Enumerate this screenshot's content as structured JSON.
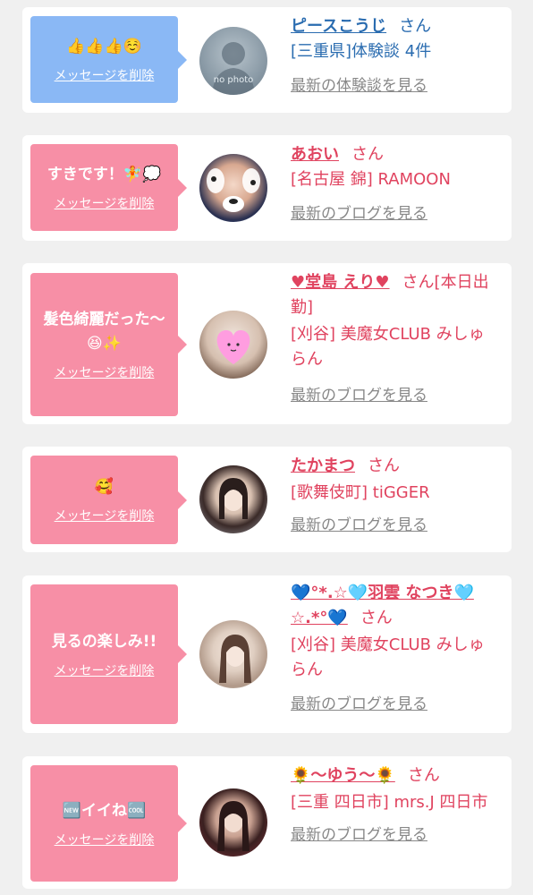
{
  "delete_label": "メッセージを削除",
  "colors": {
    "blue_bubble": "#8ab8f5",
    "pink_bubble": "#f78fa6",
    "blue_text": "#2a6cb0",
    "pink_text": "#e0435f"
  },
  "cards": [
    {
      "message": "👍👍👍☺️",
      "name": "ピースこうじ",
      "san": "さん",
      "subtitle": "[三重県]体験談 4件",
      "link": "最新の体験談を見る",
      "avatar_text": "no photo"
    },
    {
      "message": "すきです！🧚💭",
      "name": "あおい",
      "san": "さん",
      "subtitle": "[名古屋 錦] RAMOON",
      "link": "最新のブログを見る"
    },
    {
      "message": "髪色綺麗だった〜😆✨",
      "name": "♥堂島 えり♥",
      "san": "さん[本日出勤]",
      "subtitle": "[刈谷] 美魔女CLUB みしゅらん",
      "link": "最新のブログを見る"
    },
    {
      "message": "🥰",
      "name": "たかまつ",
      "san": "さん",
      "subtitle": "[歌舞伎町] tiGGER",
      "link": "最新のブログを見る"
    },
    {
      "message": "見るの楽しみ!!",
      "name": "💙°*.☆🩵羽雲 なつき🩵☆.*°💙",
      "san": "さん",
      "subtitle": "[刈谷] 美魔女CLUB みしゅらん",
      "link": "最新のブログを見る"
    },
    {
      "message": "🆕イイね🆒",
      "name": "🌻〜ゆう〜🌻",
      "san": "さん",
      "subtitle": "[三重 四日市] mrs.J 四日市",
      "link": "最新のブログを見る"
    }
  ]
}
